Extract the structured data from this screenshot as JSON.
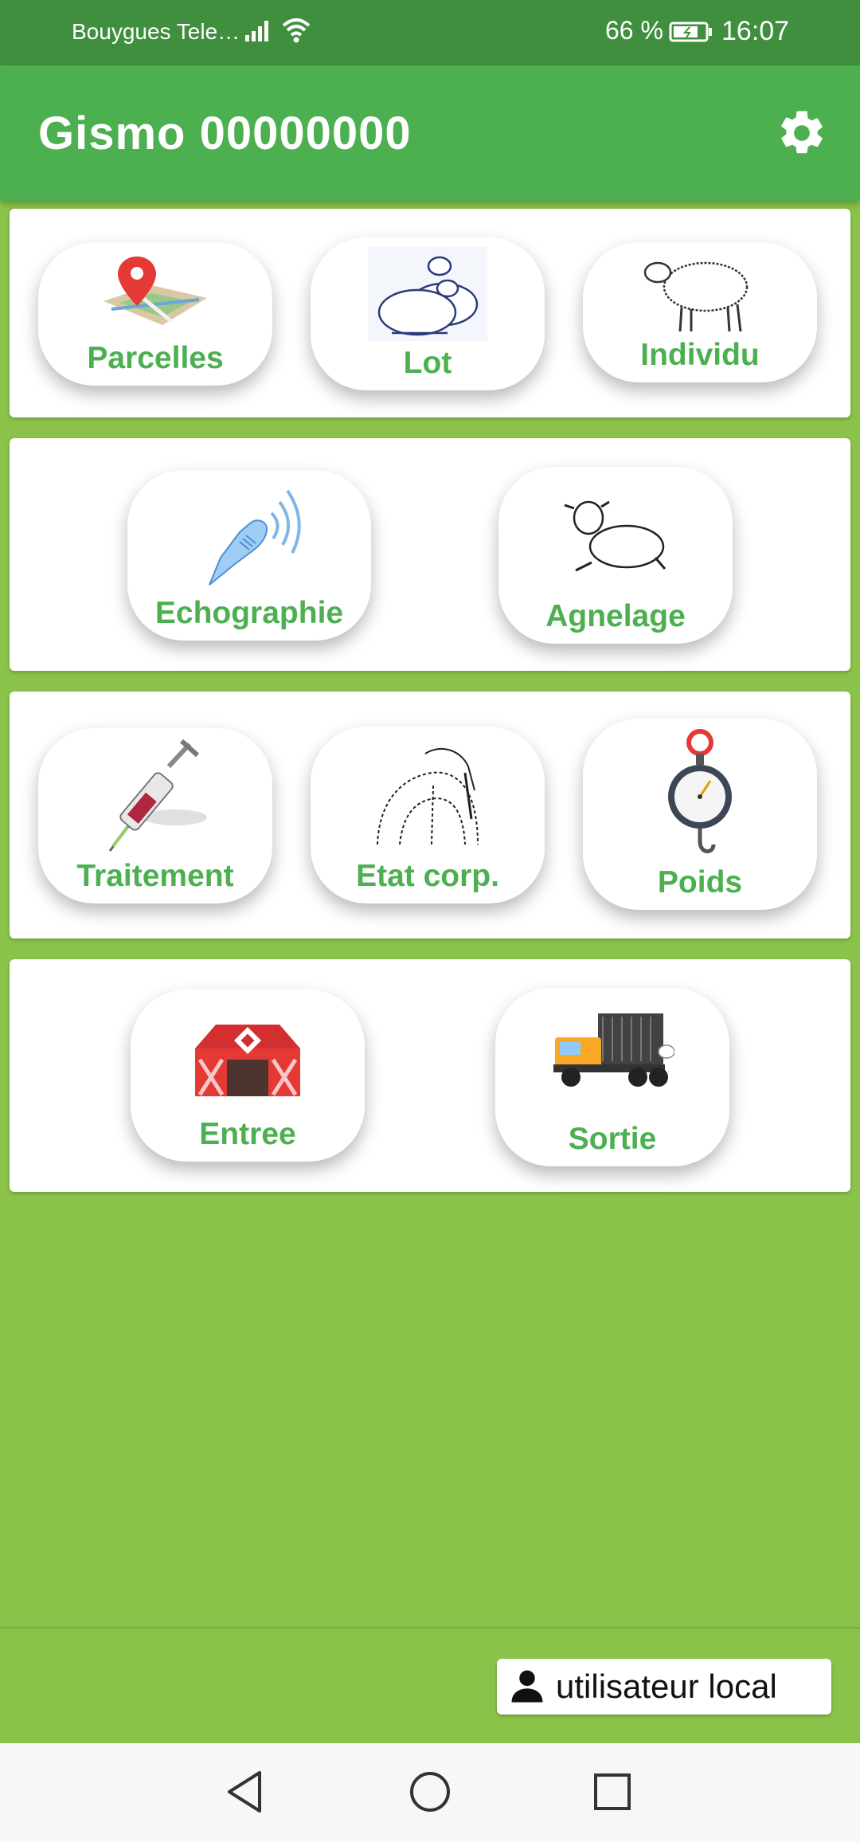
{
  "status_bar": {
    "carrier": "Bouygues Tele…",
    "battery_percent": "66 %",
    "time": "16:07",
    "icons": [
      "signal-icon",
      "wifi-icon",
      "battery-charging-icon"
    ]
  },
  "app_bar": {
    "title": "Gismo 00000000",
    "settings_icon": "gear-icon"
  },
  "sections": [
    {
      "tiles": [
        {
          "label": "Parcelles",
          "icon": "map-pin-icon"
        },
        {
          "label": "Lot",
          "icon": "sheep-group-icon"
        },
        {
          "label": "Individu",
          "icon": "sheep-icon"
        }
      ]
    },
    {
      "tiles": [
        {
          "label": "Echographie",
          "icon": "ultrasound-probe-icon"
        },
        {
          "label": "Agnelage",
          "icon": "lamb-icon"
        }
      ]
    },
    {
      "tiles": [
        {
          "label": "Traitement",
          "icon": "syringe-icon"
        },
        {
          "label": "Etat corp.",
          "icon": "body-condition-icon"
        },
        {
          "label": "Poids",
          "icon": "scale-icon"
        }
      ]
    },
    {
      "tiles": [
        {
          "label": "Entree",
          "icon": "barn-icon"
        },
        {
          "label": "Sortie",
          "icon": "truck-icon"
        }
      ]
    }
  ],
  "user": {
    "name": "utilisateur local",
    "icon": "person-icon"
  },
  "colors": {
    "background": "#8bc34a",
    "app_bar": "#4caf50",
    "status_bar": "#3f8f3f",
    "tile_label": "#4caf50"
  }
}
